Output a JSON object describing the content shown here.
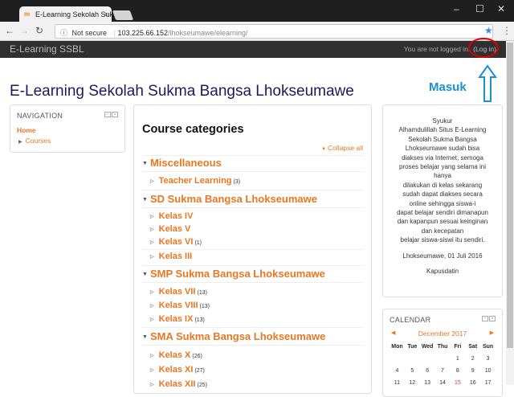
{
  "browser": {
    "tab_title": "E-Learning Sekolah Sukma",
    "tab_close": "×",
    "security": "Not secure",
    "url_host": "103.225.66.152",
    "url_path": "/lhokseumawe/elearning/"
  },
  "navbar": {
    "brand": "E-Learning SSBL",
    "login_text": "You are not logged in.",
    "login_link": "(Log in)"
  },
  "annotation": {
    "label": "Masuk",
    "color": "#1b8fd4",
    "circle_color": "#dd0000"
  },
  "site_title": "E-Learning Sekolah Sukma Bangsa Lhokseumawe",
  "navigation": {
    "heading": "NAVIGATION",
    "home": "Home",
    "courses": "Courses"
  },
  "course_categories": {
    "heading": "Course categories",
    "collapse_all": "Collapse all",
    "categories": [
      {
        "name": "Miscellaneous",
        "children": [
          {
            "name": "Teacher Learning",
            "count": "(3)"
          }
        ]
      },
      {
        "name": "SD Sukma Bangsa Lhokseumawe",
        "children": [
          {
            "name": "Kelas IV",
            "count": ""
          },
          {
            "name": "Kelas V",
            "count": ""
          },
          {
            "name": "Kelas VI",
            "count": "(1)"
          },
          {
            "name": "Kelas III",
            "count": ""
          }
        ]
      },
      {
        "name": "SMP Sukma Bangsa Lhokseumawe",
        "children": [
          {
            "name": "Kelas VII",
            "count": "(13)"
          },
          {
            "name": "Kelas VIII",
            "count": "(13)"
          },
          {
            "name": "Kelas IX",
            "count": "(13)"
          }
        ]
      },
      {
        "name": "SMA Sukma Bangsa Lhokseumawe",
        "children": [
          {
            "name": "Kelas X",
            "count": "(26)"
          },
          {
            "name": "Kelas XI",
            "count": "(27)"
          },
          {
            "name": "Kelas XII",
            "count": "(25)"
          }
        ]
      }
    ]
  },
  "info": {
    "lines": [
      "Syukur",
      "Alhamdulillah Situs E-Learning",
      "Sekolah Sukma Bangsa",
      "Lhokseumawe sudah bisa",
      "diakses via Internet, semoga",
      "proses belajar yang selama ini",
      "hanya",
      "dilakukan di kelas sekarang",
      "sudah dapat diakses secara",
      "online sehingga siswa-i",
      "dapat belajar sendiri dimanapun",
      "dan kapanpun sesuai keinginan",
      "dan kecepatan",
      "belajar siswa-siswi itu sendiri."
    ],
    "place_date": "Lhokseumawe, 01 Juli 2016",
    "signature": "Kapusdatin"
  },
  "calendar": {
    "heading": "CALENDAR",
    "month": "December 2017",
    "days": [
      "Mon",
      "Tue",
      "Wed",
      "Thu",
      "Fri",
      "Sat",
      "Sun"
    ],
    "rows": [
      [
        "",
        "",
        "",
        "",
        "1",
        "2",
        "3"
      ],
      [
        "4",
        "5",
        "6",
        "7",
        "8",
        "9",
        "10"
      ],
      [
        "11",
        "12",
        "13",
        "14",
        "15",
        "16",
        "17"
      ]
    ]
  }
}
